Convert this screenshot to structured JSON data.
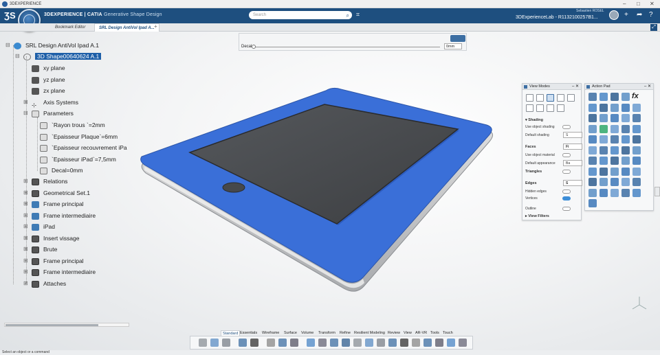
{
  "window": {
    "title": "3DEXPERIENCE"
  },
  "appbar": {
    "compass_label": "V.R",
    "brand_bold": "3DEXPERIENCE | CATIA",
    "brand_sub": "Generative Shape Design",
    "search_placeholder": "Search",
    "user_name": "Sebastien ROSEL",
    "tenant": "3DExperienceLab - R1132100257B1..."
  },
  "tabs": [
    {
      "label": "Bookmark Editor",
      "active": false
    },
    {
      "label": "SRL Design AntiVol Ipad A...",
      "active": true
    }
  ],
  "tree": {
    "root": "SRL Design AntiVol Ipad A.1",
    "shape": "3D Shape00640624 A.1",
    "planes": [
      "xy plane",
      "yz plane",
      "zx plane"
    ],
    "axis_systems": "Axis Systems",
    "parameters": "Parameters",
    "params": [
      "`Rayon trous `=2mm",
      "`Epaisseur Plaque`=6mm",
      "`Epaisseur recouvrement iPa",
      "`Epaisseur iPad`=7,5mm",
      "Decal=0mm"
    ],
    "items": [
      "Relations",
      "Geometrical Set.1",
      "Frame principal",
      "Frame intermediaire",
      "iPad",
      "Insert vissage",
      "Brute",
      "Frame principal",
      "Frame intermediaire",
      "Attaches"
    ]
  },
  "decal": {
    "label": "Decal",
    "value": "0mm",
    "level": 0.0
  },
  "view_modes": {
    "title": "View Modes",
    "shading": "Shading",
    "use_object_shading": "Use object shading",
    "default_shading": "Default shading",
    "faces": "Faces",
    "use_object_material": "Use object material",
    "default_appearance": "Default appearance",
    "triangles": "Triangles",
    "edges": "Edges",
    "hidden_edges": "Hidden edges",
    "vertices": "Vertices",
    "outline": "Outline",
    "view_filters": "View Filters",
    "dd_shading": "S",
    "dd_faces": "Fi",
    "dd_appearance": "Ba",
    "dd_edges": "S"
  },
  "action_pad": {
    "title": "Action Pad",
    "fx": "fx"
  },
  "workbench_tabs": [
    "Standard",
    "Essentials",
    "Wireframe",
    "Surface",
    "Volume",
    "Transform",
    "Refine",
    "Resilient Modeling",
    "Review",
    "View",
    "AR-VR",
    "Tools",
    "Touch"
  ],
  "status": {
    "text": "Select an object or a command"
  },
  "colors": {
    "appbar": "#1e4f7f",
    "frame_blue": "#3a6fd8",
    "selection": "#1e5fa8",
    "screen": "#4a4c4f"
  }
}
